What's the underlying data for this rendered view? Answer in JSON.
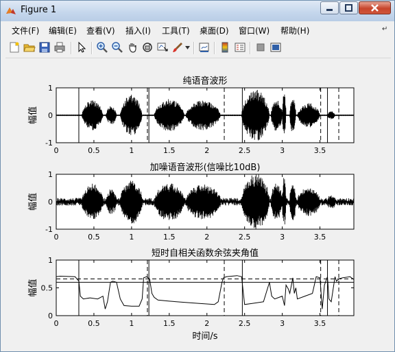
{
  "window": {
    "title": "Figure 1"
  },
  "menu": [
    "文件(F)",
    "编辑(E)",
    "查看(V)",
    "插入(I)",
    "工具(T)",
    "桌面(D)",
    "窗口(W)",
    "帮助(H)"
  ],
  "toolbar": {
    "icons": [
      "new-figure-icon",
      "open-file-icon",
      "save-icon",
      "print-icon",
      "pointer-icon",
      "zoom-in-icon",
      "zoom-out-icon",
      "pan-icon",
      "rotate-3d-icon",
      "data-cursor-icon",
      "brush-icon",
      "link-plot-icon",
      "colorbar-icon",
      "legend-icon",
      "hide-plot-tools-icon",
      "show-plot-tools-icon"
    ]
  },
  "chart_data": [
    {
      "type": "line",
      "title": "纯语音波形",
      "xlabel": "",
      "ylabel": "幅值",
      "xlim": [
        0,
        3.95
      ],
      "ylim": [
        -1,
        1
      ],
      "xticks": [
        "0",
        "0.5",
        "1",
        "1.5",
        "2",
        "2.5",
        "3",
        "3.5"
      ],
      "yticks": [
        "-1",
        "0",
        "1"
      ],
      "series": [
        {
          "style": "waveform",
          "segments": [
            {
              "x": [
                0.34,
                0.62
              ],
              "amp": 0.55
            },
            {
              "x": [
                0.66,
                0.8
              ],
              "amp": 0.35
            },
            {
              "x": [
                0.85,
                1.14
              ],
              "amp": 0.75
            },
            {
              "x": [
                1.3,
                1.7
              ],
              "amp": 0.6
            },
            {
              "x": [
                1.72,
                2.18
              ],
              "amp": 0.55
            },
            {
              "x": [
                2.46,
                2.83
              ],
              "amp": 0.95
            },
            {
              "x": [
                2.85,
                3.0
              ],
              "amp": 0.6
            },
            {
              "x": [
                3.0,
                3.05
              ],
              "amp": 0.85
            },
            {
              "x": [
                3.1,
                3.18
              ],
              "amp": 0.7
            },
            {
              "x": [
                3.2,
                3.5
              ],
              "amp": 0.45
            },
            {
              "x": [
                3.6,
                3.7
              ],
              "amp": 0.15
            }
          ]
        }
      ],
      "solid_vlines": [
        0.3,
        1.23,
        2.47,
        3.6
      ],
      "dashed_vlines": [
        1.21,
        2.23,
        3.51,
        3.75
      ]
    },
    {
      "type": "line",
      "title": "加噪语音波形(信噪比10dB)",
      "xlabel": "",
      "ylabel": "幅值",
      "xlim": [
        0,
        3.95
      ],
      "ylim": [
        -1,
        1
      ],
      "xticks": [
        "0",
        "0.5",
        "1",
        "1.5",
        "2",
        "2.5",
        "3",
        "3.5"
      ],
      "yticks": [
        "-1",
        "0",
        "1"
      ],
      "series": [
        {
          "style": "noisy-waveform",
          "noise_amp": 0.13,
          "segments": [
            {
              "x": [
                0.34,
                0.62
              ],
              "amp": 0.55
            },
            {
              "x": [
                0.66,
                0.8
              ],
              "amp": 0.35
            },
            {
              "x": [
                0.85,
                1.14
              ],
              "amp": 0.75
            },
            {
              "x": [
                1.3,
                1.7
              ],
              "amp": 0.6
            },
            {
              "x": [
                1.72,
                2.18
              ],
              "amp": 0.55
            },
            {
              "x": [
                2.46,
                2.83
              ],
              "amp": 0.95
            },
            {
              "x": [
                2.85,
                3.0
              ],
              "amp": 0.6
            },
            {
              "x": [
                3.0,
                3.05
              ],
              "amp": 0.85
            },
            {
              "x": [
                3.1,
                3.18
              ],
              "amp": 0.7
            },
            {
              "x": [
                3.2,
                3.5
              ],
              "amp": 0.45
            },
            {
              "x": [
                3.6,
                3.7
              ],
              "amp": 0.15
            }
          ]
        }
      ]
    },
    {
      "type": "line",
      "title": "短时自相关函数余弦夹角值",
      "xlabel": "时间/s",
      "ylabel": "幅值",
      "xlim": [
        0,
        3.95
      ],
      "ylim": [
        0,
        1
      ],
      "xticks": [
        "0",
        "0.5",
        "1",
        "1.5",
        "2",
        "2.5",
        "3",
        "3.5"
      ],
      "yticks": [
        "0",
        "0.5",
        "1"
      ],
      "series": [
        {
          "x": [
            0,
            0.05,
            0.25,
            0.3,
            0.32,
            0.36,
            0.45,
            0.55,
            0.62,
            0.65,
            0.68,
            0.72,
            0.75,
            0.8,
            0.85,
            0.9,
            1.0,
            1.1,
            1.14,
            1.16,
            1.2,
            1.24,
            1.27,
            1.3,
            1.35,
            1.5,
            1.7,
            1.9,
            2.1,
            2.15,
            2.2,
            2.22,
            2.26,
            2.4,
            2.46,
            2.5,
            2.6,
            2.75,
            2.83,
            2.86,
            2.9,
            3.0,
            3.03,
            3.05,
            3.08,
            3.1,
            3.14,
            3.16,
            3.18,
            3.2,
            3.3,
            3.4,
            3.45,
            3.5,
            3.53,
            3.56,
            3.6,
            3.62,
            3.65,
            3.7,
            3.72,
            3.75,
            3.8,
            3.9,
            3.95
          ],
          "y": [
            0.7,
            0.71,
            0.7,
            0.62,
            0.35,
            0.3,
            0.32,
            0.3,
            0.35,
            0.12,
            0.25,
            0.6,
            0.62,
            0.6,
            0.3,
            0.18,
            0.17,
            0.17,
            0.3,
            0.68,
            0.7,
            0.66,
            0.4,
            0.33,
            0.28,
            0.26,
            0.24,
            0.22,
            0.2,
            0.25,
            0.6,
            0.68,
            0.7,
            0.72,
            0.7,
            0.2,
            0.22,
            0.25,
            0.6,
            0.35,
            0.3,
            0.35,
            0.18,
            0.55,
            0.48,
            0.4,
            0.68,
            0.4,
            0.5,
            0.3,
            0.35,
            0.4,
            0.7,
            0.68,
            0.12,
            0.55,
            0.7,
            0.3,
            0.25,
            0.7,
            0.62,
            0.66,
            0.68,
            0.7,
            0.65
          ]
        }
      ],
      "hlines": [
        {
          "y": 0.66,
          "style": "dashed"
        },
        {
          "y": 0.6,
          "style": "solid"
        }
      ],
      "solid_vlines": [
        0.3,
        1.23,
        2.47,
        3.6
      ],
      "dashed_vlines": [
        1.21,
        2.23,
        3.51,
        3.75
      ]
    }
  ]
}
